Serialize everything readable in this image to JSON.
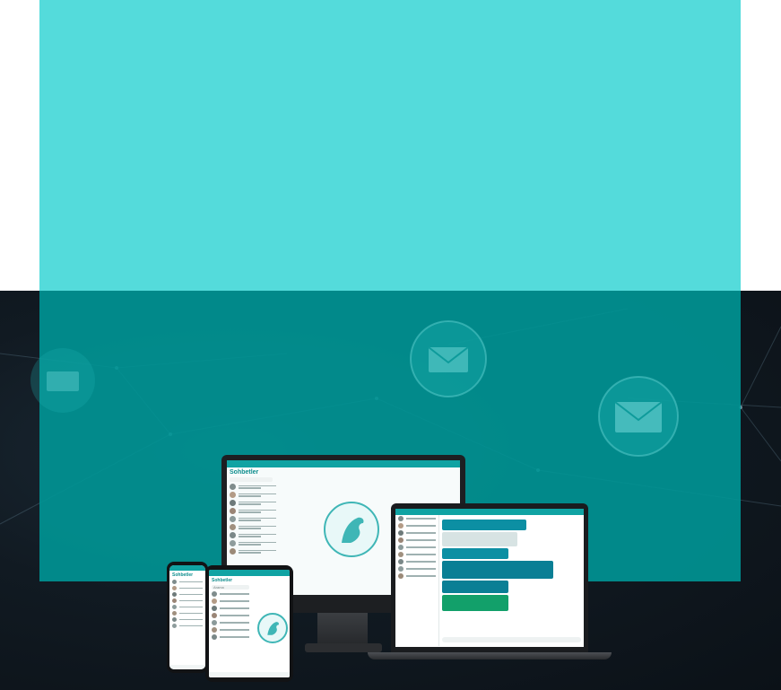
{
  "colors": {
    "hero_top": "#54dbdb",
    "hero_bottom": "#009696",
    "background_dark": "#111a22",
    "accent": "#10a3a3",
    "send_green": "#12a06a"
  },
  "devices": {
    "monitor": {
      "app_title": "Sohbetler"
    },
    "tablet": {
      "app_title": "Sohbetler",
      "search_placeholder": "Arama"
    },
    "phone": {
      "app_title": "Sohbetler"
    },
    "laptop": {
      "app_title": ""
    }
  },
  "icons": [
    "envelope-icon",
    "horse-logo-icon"
  ]
}
